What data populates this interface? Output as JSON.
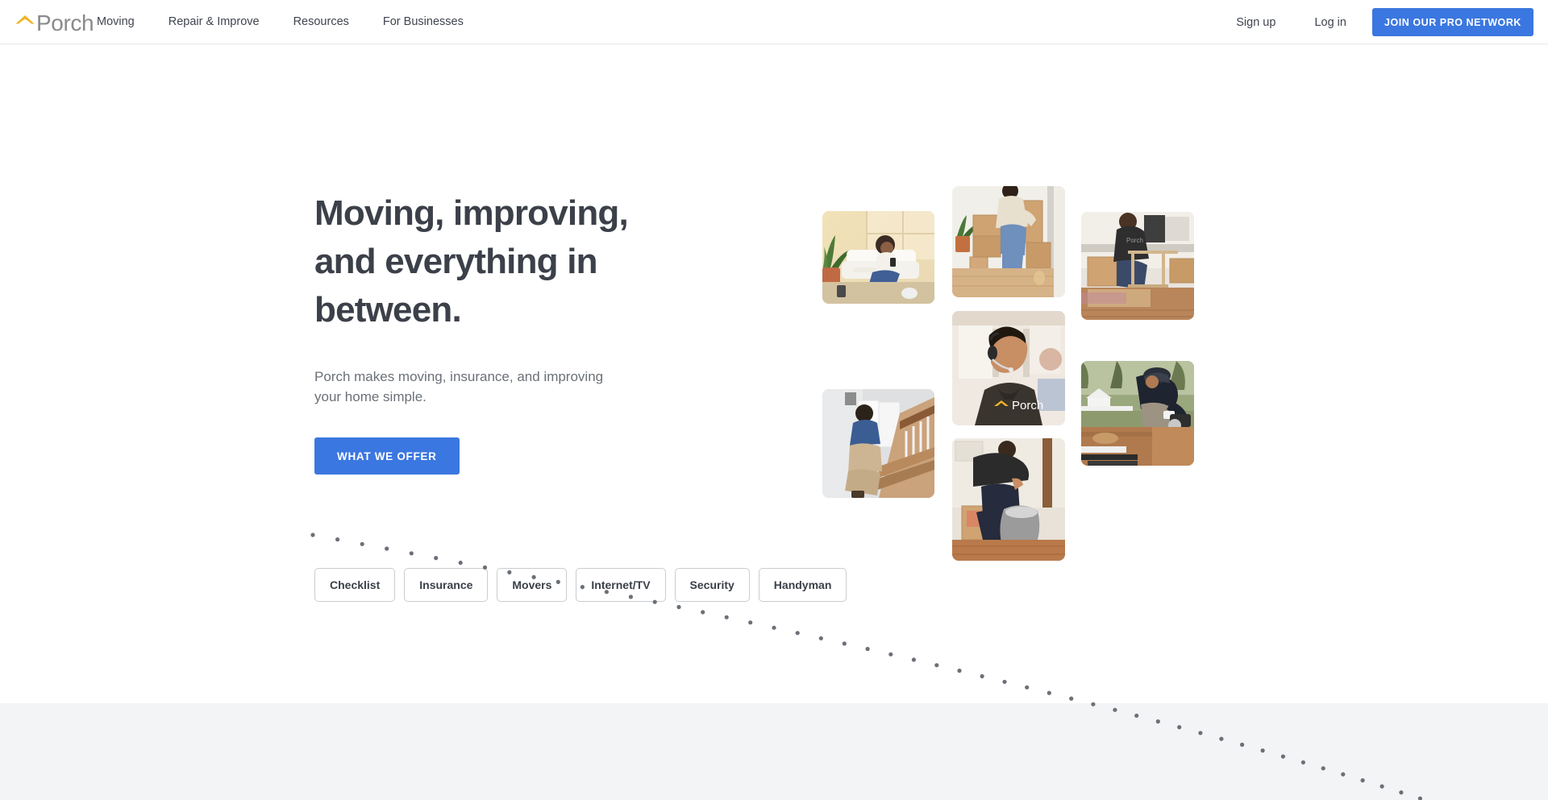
{
  "header": {
    "logo": {
      "name": "Porch",
      "icon": "porch-chevron-roof-icon",
      "chevron_color": "#f0b323",
      "text_color": "#8a8a8a"
    },
    "nav": [
      {
        "label": "Moving"
      },
      {
        "label": "Repair & Improve"
      },
      {
        "label": "Resources"
      },
      {
        "label": "For Businesses"
      }
    ],
    "signup_label": "Sign up",
    "login_label": "Log in",
    "pro_button_label": "JOIN OUR PRO NETWORK",
    "pro_button_color": "#3b77e0"
  },
  "hero": {
    "title_line1": "Moving, improving,",
    "title_line2": "and everything in",
    "title_line3": "between.",
    "subtitle_line1": "Porch makes moving, insurance, and improving",
    "subtitle_line2": "your home simple.",
    "cta_label": "WHAT WE OFFER",
    "cta_color": "#3b77e0",
    "title_color": "#3b4049"
  },
  "categories": [
    {
      "label": "Checklist"
    },
    {
      "label": "Insurance"
    },
    {
      "label": "Movers"
    },
    {
      "label": "Internet/TV"
    },
    {
      "label": "Security"
    },
    {
      "label": "Handyman"
    }
  ],
  "collage": {
    "images": [
      {
        "id": "woman-on-phone-livingroom",
        "alt": "Woman sitting on living room floor using phone"
      },
      {
        "id": "worker-carrying-panels-stairs",
        "alt": "Worker in blue polo carrying panels up stairs"
      },
      {
        "id": "woman-packing-boxes",
        "alt": "Woman packing moving boxes in hallway"
      },
      {
        "id": "porch-agent-headset",
        "alt": "Smiling Porch support agent wearing a headset"
      },
      {
        "id": "mover-packing-bag",
        "alt": "Mover bending over packing items into a gray bag"
      },
      {
        "id": "porch-pro-assembling-table",
        "alt": "Porch pro assembling a table near moving boxes"
      },
      {
        "id": "contractor-sawing-wood",
        "alt": "Contractor using a circular saw on wood outdoors"
      }
    ]
  },
  "decoration": {
    "dotted_arc_color": "#6b7078",
    "lower_section_color": "#f3f4f6"
  }
}
